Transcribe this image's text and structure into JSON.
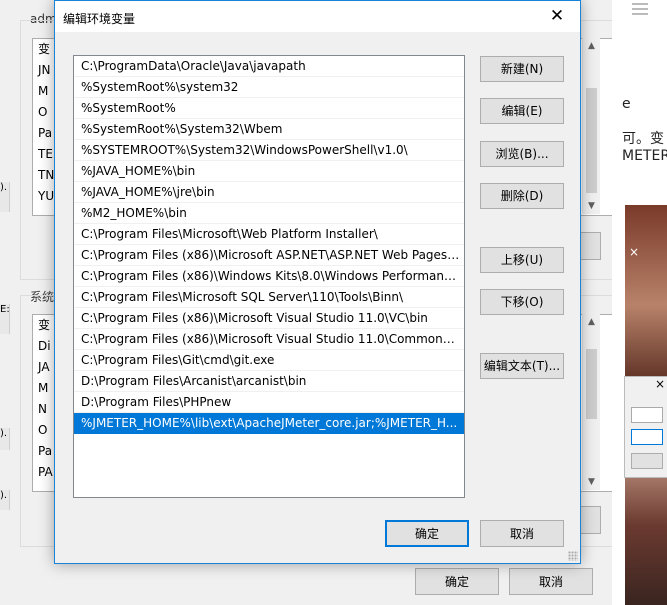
{
  "background_window": {
    "user_vars_label": "adm",
    "user_list": [
      "变",
      "JN",
      "M",
      "O",
      "Pa",
      "TE",
      "TN",
      "YU"
    ],
    "system_vars_label": "系统",
    "system_list": [
      "变",
      "Di",
      "JA",
      "M",
      "N",
      "O",
      "Pa",
      "PA"
    ],
    "left_strip_texts": [
      ").",
      "E:).",
      ").",
      ")."
    ],
    "ok_label": "确定",
    "cancel_label": "取消"
  },
  "right_app": {
    "fragment_1": "可。变",
    "fragment_2": "METER",
    "fragment_3": "e",
    "close_glyph": "×",
    "close_glyph_2": "×"
  },
  "dialog": {
    "title": "编辑环境变量",
    "close_glyph": "✕",
    "paths": [
      "C:\\ProgramData\\Oracle\\Java\\javapath",
      "%SystemRoot%\\system32",
      "%SystemRoot%",
      "%SystemRoot%\\System32\\Wbem",
      "%SYSTEMROOT%\\System32\\WindowsPowerShell\\v1.0\\",
      "%JAVA_HOME%\\bin",
      "%JAVA_HOME%\\jre\\bin",
      "%M2_HOME%\\bin",
      "C:\\Program Files\\Microsoft\\Web Platform Installer\\",
      "C:\\Program Files (x86)\\Microsoft ASP.NET\\ASP.NET Web Pages\\...",
      "C:\\Program Files (x86)\\Windows Kits\\8.0\\Windows Performance...",
      "C:\\Program Files\\Microsoft SQL Server\\110\\Tools\\Binn\\",
      "C:\\Program Files (x86)\\Microsoft Visual Studio 11.0\\VC\\bin",
      "C:\\Program Files (x86)\\Microsoft Visual Studio 11.0\\Common7\\I...",
      "C:\\Program Files\\Git\\cmd\\git.exe",
      "D:\\Program Files\\Arcanist\\arcanist\\bin",
      "D:\\Program Files\\PHPnew",
      "%JMETER_HOME%\\lib\\ext\\ApacheJMeter_core.jar;%JMETER_H..."
    ],
    "selected_index": 17,
    "buttons": {
      "new": "新建(N)",
      "edit": "编辑(E)",
      "browse": "浏览(B)...",
      "delete": "删除(D)",
      "move_up": "上移(U)",
      "move_down": "下移(O)",
      "edit_text": "编辑文本(T)..."
    },
    "ok_label": "确定",
    "cancel_label": "取消"
  },
  "colors": {
    "accent": "#0078d7",
    "dialog_border": "#1883d7",
    "selection_text": "#ffffff"
  }
}
